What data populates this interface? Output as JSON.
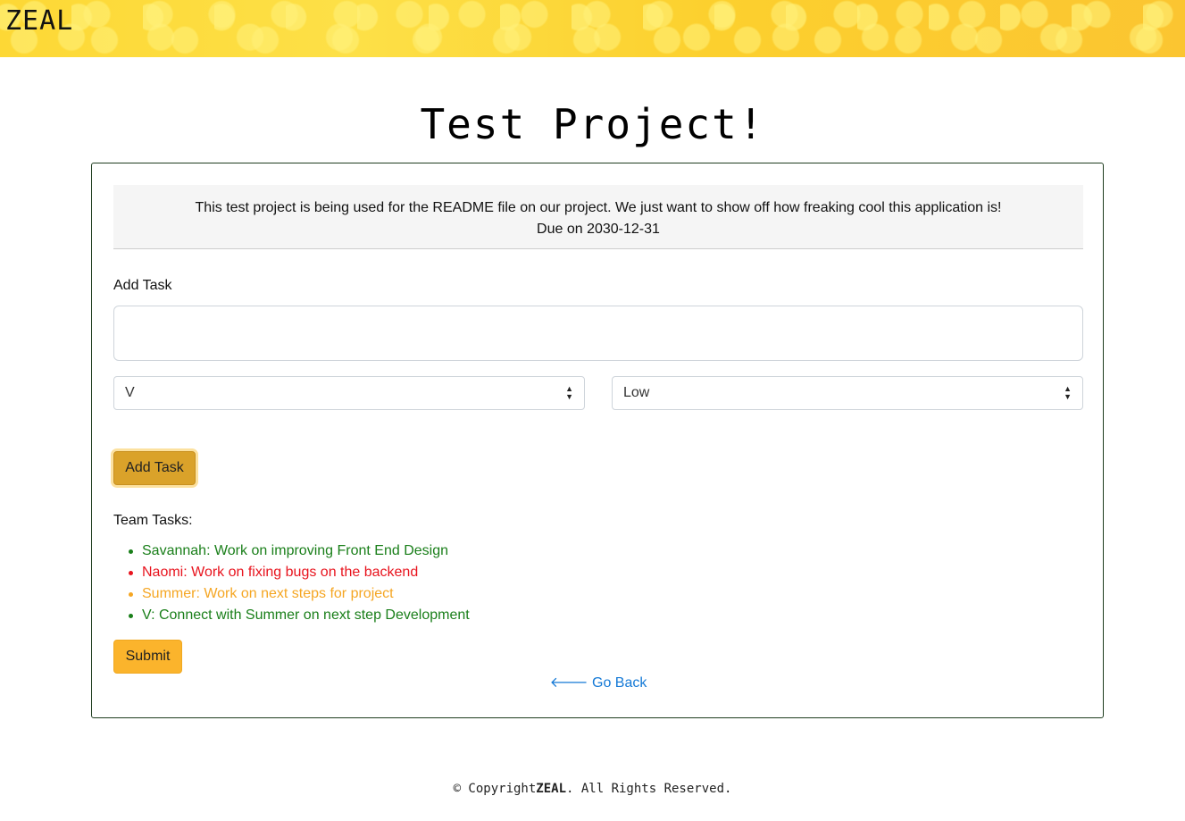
{
  "header": {
    "brand": "ZEAL"
  },
  "project": {
    "title": "Test Project!",
    "description": "This test project is being used for the README file on our project. We just want to show off how freaking cool this application is!",
    "due": "Due on 2030-12-31"
  },
  "form": {
    "add_task_label": "Add Task",
    "task_value": "",
    "assignee_selected": "V",
    "priority_selected": "Low",
    "add_task_button": "Add Task"
  },
  "team": {
    "label": "Team Tasks:",
    "tasks": [
      {
        "text": "Savannah: Work on improving Front End Design",
        "color": "#1a7f1a"
      },
      {
        "text": "Naomi: Work on fixing bugs on the backend",
        "color": "#e8141e"
      },
      {
        "text": "Summer: Work on next steps for project",
        "color": "#f5a623"
      },
      {
        "text": "V: Connect with Summer on next step Development",
        "color": "#1a7f1a"
      }
    ]
  },
  "actions": {
    "submit": "Submit",
    "go_back": "🡐 Go Back"
  },
  "footer": {
    "prefix": "© Copyright",
    "brand": "ZEAL",
    "suffix": ". All Rights Reserved."
  },
  "colors": {
    "accent": "#fbb42c",
    "add_button": "#daa22a",
    "link": "#1479d6"
  }
}
